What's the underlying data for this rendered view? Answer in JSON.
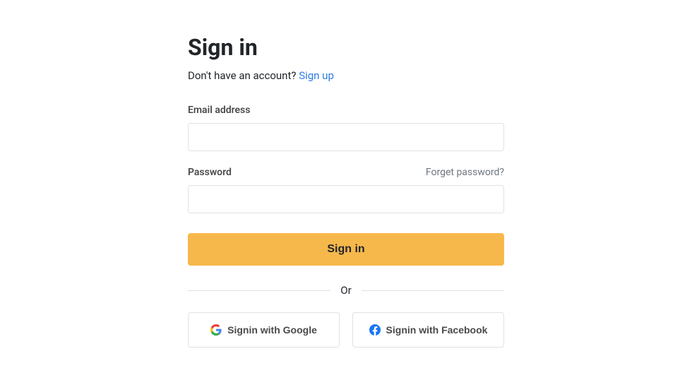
{
  "title": "Sign in",
  "subtitle": {
    "text": "Don't have an account? ",
    "link": "Sign up"
  },
  "form": {
    "email": {
      "label": "Email address"
    },
    "password": {
      "label": "Password",
      "forgot": "Forget password?"
    },
    "submit": "Sign in"
  },
  "divider": "Or",
  "social": {
    "google": "Signin with Google",
    "facebook": "Signin with Facebook"
  }
}
